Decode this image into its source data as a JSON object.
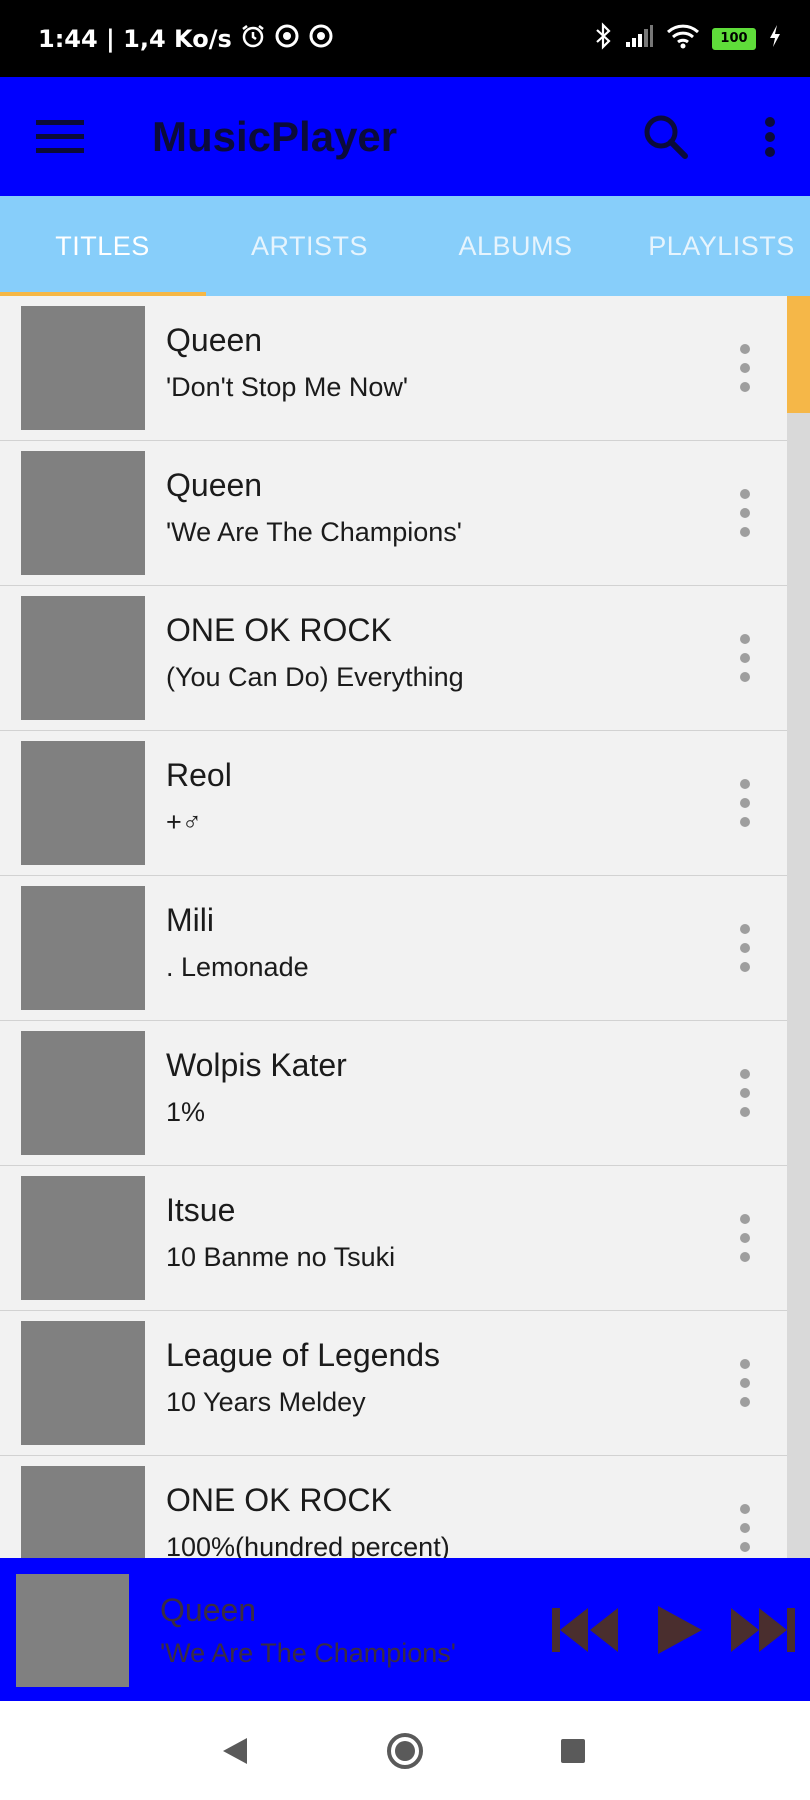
{
  "status_bar": {
    "time_speed": "1:44 | 1,4 Ko/s",
    "battery": "100"
  },
  "app_bar": {
    "title": "MusicPlayer"
  },
  "tabs": [
    {
      "label": "TITLES",
      "active": true
    },
    {
      "label": "ARTISTS",
      "active": false
    },
    {
      "label": "ALBUMS",
      "active": false
    },
    {
      "label": "PLAYLISTS",
      "active": false
    }
  ],
  "songs": [
    {
      "artist": "Queen",
      "title": "'Don't Stop Me Now'"
    },
    {
      "artist": "Queen",
      "title": "'We Are The Champions'"
    },
    {
      "artist": "ONE OK ROCK",
      "title": "(You Can Do) Everything"
    },
    {
      "artist": "Reol",
      "title": "+♂"
    },
    {
      "artist": "Mili",
      "title": ". Lemonade"
    },
    {
      "artist": "Wolpis Kater",
      "title": "1%"
    },
    {
      "artist": "Itsue",
      "title": "10 Banme no Tsuki"
    },
    {
      "artist": "League of Legends",
      "title": "10 Years Meldey"
    },
    {
      "artist": "ONE OK ROCK",
      "title": "100%(hundred percent)"
    }
  ],
  "now_playing": {
    "artist": "Queen",
    "title": "'We Are The Champions'"
  },
  "colors": {
    "app_bar": "#0000ff",
    "tab_bar": "#87cefa",
    "indicator": "#f6b745",
    "thumbnail": "#808080"
  },
  "icons": {
    "menu": "hamburger-menu-icon",
    "search": "search-icon",
    "overflow": "more-vert-icon",
    "previous": "skip-previous-icon",
    "play": "play-icon",
    "next": "skip-next-icon"
  }
}
